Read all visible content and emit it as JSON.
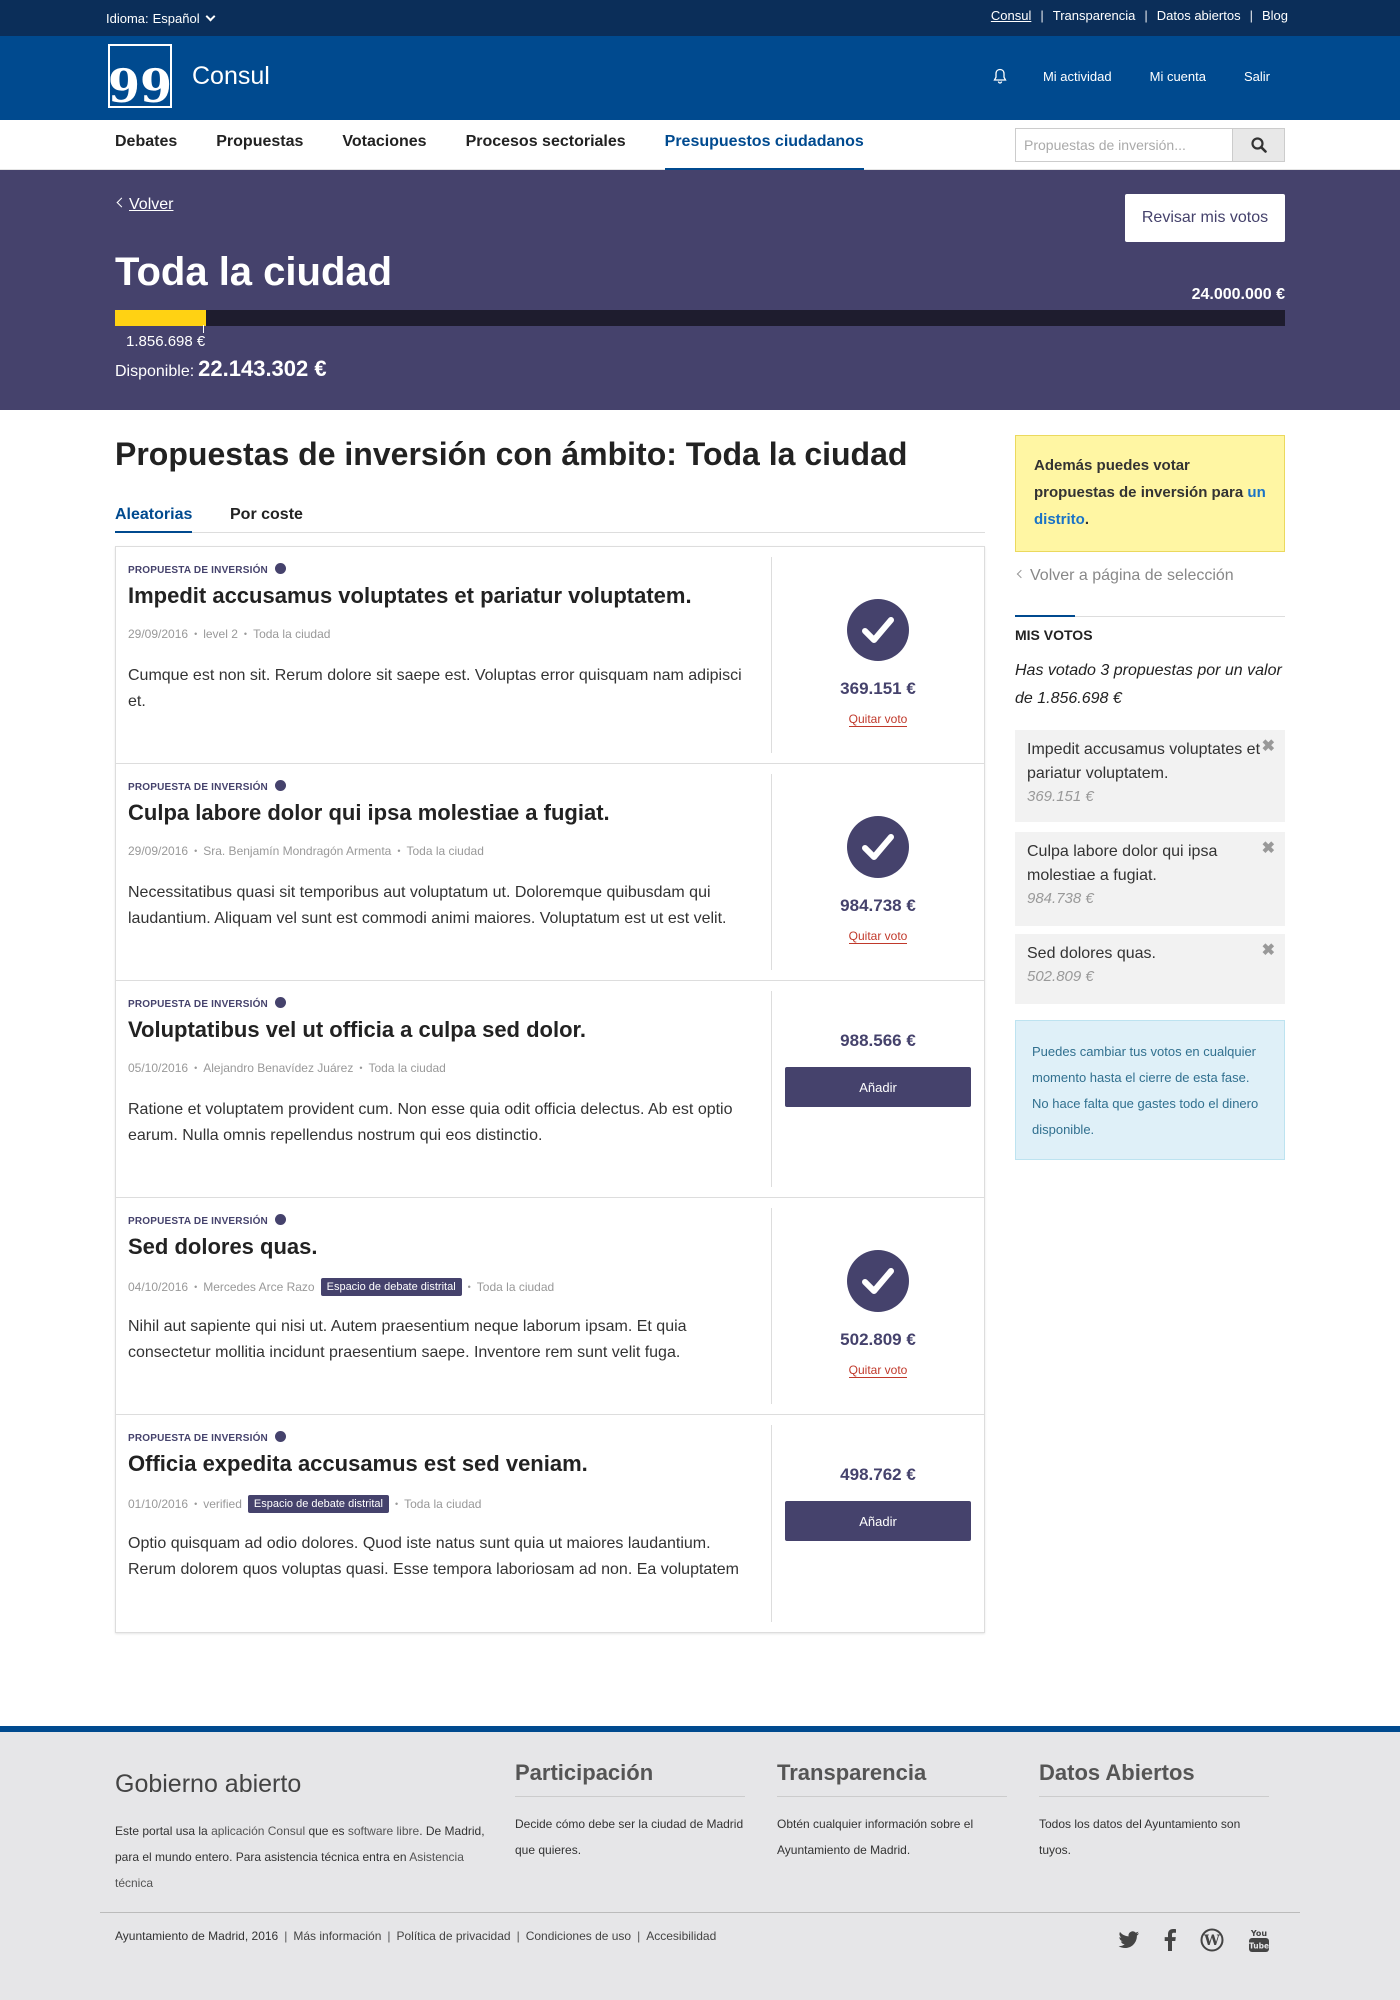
{
  "topbar": {
    "language_label": "Idioma:",
    "language_value": "Español",
    "links": [
      "Consul",
      "Transparencia",
      "Datos abiertos",
      "Blog"
    ]
  },
  "header": {
    "logo_glyph": "99",
    "brand": "Consul",
    "user_links": [
      "Mi actividad",
      "Mi cuenta",
      "Salir"
    ]
  },
  "nav": {
    "items": [
      "Debates",
      "Propuestas",
      "Votaciones",
      "Procesos sectoriales",
      "Presupuestos ciudadanos"
    ],
    "active_index": 4,
    "search_placeholder": "Propuestas de inversión..."
  },
  "hero": {
    "back_label": "Volver",
    "review_button": "Revisar mis votos",
    "title": "Toda la ciudad",
    "total": "24.000.000 €",
    "spent": "1.856.698 €",
    "available_label": "Disponible:",
    "available_value": "22.143.302 €",
    "progress_fraction": 0.0774,
    "colors": {
      "background": "#45426c",
      "fill": "#ffd213",
      "track": "#1e1c2e"
    }
  },
  "content": {
    "heading": "Propuestas de inversión con ámbito: Toda la ciudad",
    "tabs": [
      "Aleatorias",
      "Por coste"
    ],
    "active_tab": 0,
    "proposals": [
      {
        "label": "PROPUESTA DE INVERSIÓN",
        "title": "Impedit accusamus voluptates et pariatur voluptatem.",
        "date": "29/09/2016",
        "author": "level 2",
        "tag": "",
        "scope": "Toda la ciudad",
        "description": "Cumque est non sit. Rerum dolore sit saepe est. Voluptas error quisquam nam adipisci et.",
        "price": "369.151 €",
        "voted": true,
        "remove_label": "Quitar voto",
        "add_label": "Añadir"
      },
      {
        "label": "PROPUESTA DE INVERSIÓN",
        "title": "Culpa labore dolor qui ipsa molestiae a fugiat.",
        "date": "29/09/2016",
        "author": "Sra. Benjamín Mondragón Armenta",
        "tag": "",
        "scope": "Toda la ciudad",
        "description": "Necessitatibus quasi sit temporibus aut voluptatum ut. Doloremque quibusdam qui laudantium. Aliquam vel sunt est commodi animi maiores. Voluptatum est ut est velit.",
        "price": "984.738 €",
        "voted": true,
        "remove_label": "Quitar voto",
        "add_label": "Añadir"
      },
      {
        "label": "PROPUESTA DE INVERSIÓN",
        "title": "Voluptatibus vel ut officia a culpa sed dolor.",
        "date": "05/10/2016",
        "author": "Alejandro Benavídez Juárez",
        "tag": "",
        "scope": "Toda la ciudad",
        "description": "Ratione et voluptatem provident cum. Non esse quia odit officia delectus. Ab est optio earum. Nulla omnis repellendus nostrum qui eos distinctio.",
        "price": "988.566 €",
        "voted": false,
        "remove_label": "Quitar voto",
        "add_label": "Añadir"
      },
      {
        "label": "PROPUESTA DE INVERSIÓN",
        "title": "Sed dolores quas.",
        "date": "04/10/2016",
        "author": "Mercedes Arce Razo",
        "tag": "Espacio de debate distrital",
        "scope": "Toda la ciudad",
        "description": "Nihil aut sapiente qui nisi ut. Autem praesentium neque laborum ipsam. Et quia consectetur mollitia incidunt praesentium saepe. Inventore rem sunt velit fuga.",
        "price": "502.809 €",
        "voted": true,
        "remove_label": "Quitar voto",
        "add_label": "Añadir"
      },
      {
        "label": "PROPUESTA DE INVERSIÓN",
        "title": "Officia expedita accusamus est sed veniam.",
        "date": "01/10/2016",
        "author": "verified",
        "tag": "Espacio de debate distrital",
        "scope": "Toda la ciudad",
        "description": "Optio quisquam ad odio dolores. Quod iste natus sunt quia ut maiores laudantium. Rerum dolorem quos voluptas quasi. Esse tempora laboriosam ad non. Ea voluptatem",
        "price": "498.762 €",
        "voted": false,
        "remove_label": "Quitar voto",
        "add_label": "Añadir"
      }
    ]
  },
  "sidebar": {
    "notice_text": "Además puedes votar propuestas de inversión para ",
    "notice_link": "un distrito",
    "notice_end": ".",
    "back_selection": "Volver a página de selección",
    "my_votes_heading": "MIS VOTOS",
    "my_votes_summary": "Has votado 3 propuestas por un valor de 1.856.698 €",
    "votes": [
      {
        "title": "Impedit accusamus voluptates et pariatur voluptatem.",
        "price": "369.151 €"
      },
      {
        "title": "Culpa labore dolor qui ipsa molestiae a fugiat.",
        "price": "984.738 €"
      },
      {
        "title": "Sed dolores quas.",
        "price": "502.809 €"
      }
    ],
    "info": "Puedes cambiar tus votos en cualquier momento hasta el cierre de esta fase. No hace falta que gastes todo el dinero disponible."
  },
  "footer": {
    "gov_title": "Gobierno abierto",
    "gov_text_1": "Este portal usa la ",
    "gov_link_1": "aplicación Consul",
    "gov_text_2": " que es ",
    "gov_link_2": "software libre",
    "gov_text_3": ". De Madrid, para el mundo entero. Para asistencia técnica entra en ",
    "gov_link_3": "Asistencia técnica",
    "columns": [
      {
        "title": "Participación",
        "text": "Decide cómo debe ser la ciudad de Madrid que quieres."
      },
      {
        "title": "Transparencia",
        "text": "Obtén cualquier información sobre el Ayuntamiento de Madrid."
      },
      {
        "title": "Datos Abiertos",
        "text": "Todos los datos del Ayuntamiento son tuyos."
      }
    ],
    "bottom_links": [
      "Ayuntamiento de Madrid, 2016",
      "Más información",
      "Política de privacidad",
      "Condiciones de uso",
      "Accesibilidad"
    ],
    "social": [
      "twitter-icon",
      "facebook-icon",
      "wordpress-icon",
      "youtube-icon"
    ]
  }
}
